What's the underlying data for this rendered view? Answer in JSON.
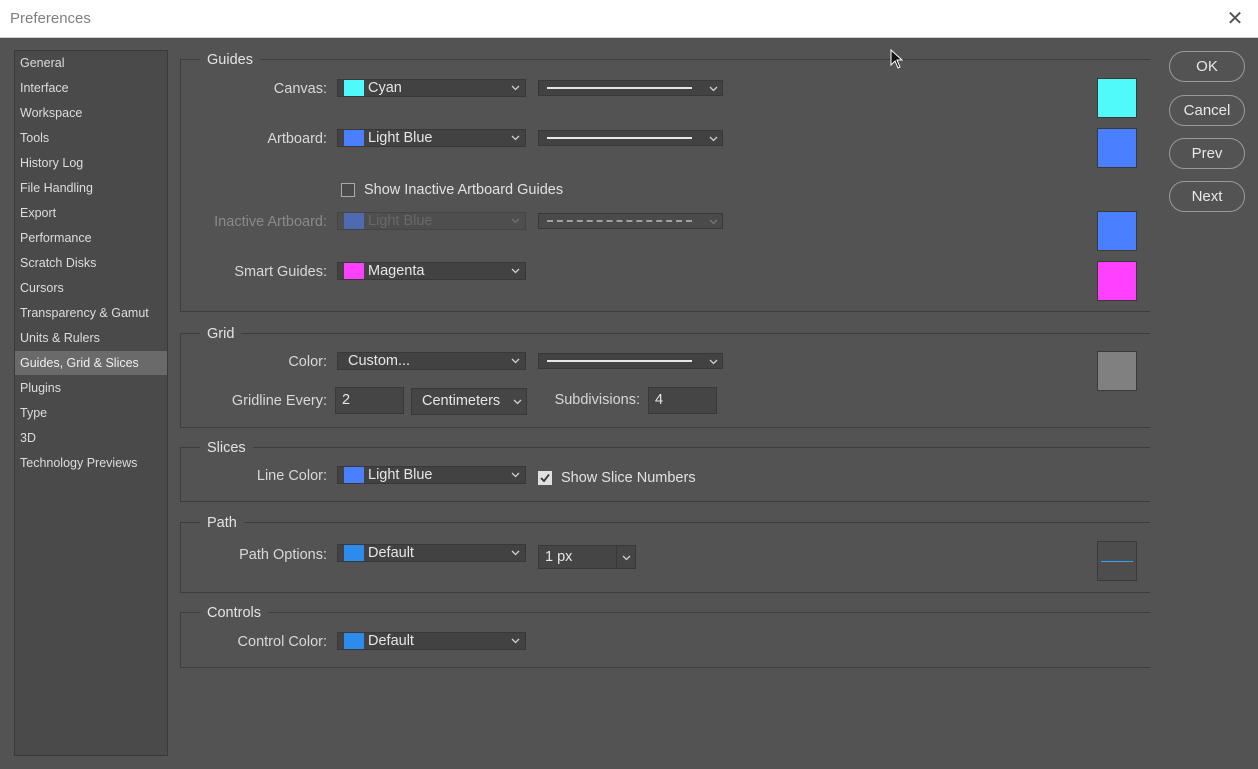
{
  "window": {
    "title": "Preferences",
    "close_glyph": "✕"
  },
  "sidebar": {
    "items": [
      {
        "label": "General"
      },
      {
        "label": "Interface"
      },
      {
        "label": "Workspace"
      },
      {
        "label": "Tools"
      },
      {
        "label": "History Log"
      },
      {
        "label": "File Handling"
      },
      {
        "label": "Export"
      },
      {
        "label": "Performance"
      },
      {
        "label": "Scratch Disks"
      },
      {
        "label": "Cursors"
      },
      {
        "label": "Transparency & Gamut"
      },
      {
        "label": "Units & Rulers"
      },
      {
        "label": "Guides, Grid & Slices"
      },
      {
        "label": "Plugins"
      },
      {
        "label": "Type"
      },
      {
        "label": "3D"
      },
      {
        "label": "Technology Previews"
      }
    ],
    "active": "Guides, Grid & Slices"
  },
  "guides": {
    "heading": "Guides",
    "canvas": {
      "label": "Canvas:",
      "color_name": "Cyan",
      "color": "#50fafa",
      "line_style": "solid"
    },
    "artboard": {
      "label": "Artboard:",
      "color_name": "Light Blue",
      "color": "#4a80ff",
      "line_style": "solid"
    },
    "show_inactive": {
      "label": "Show Inactive Artboard Guides",
      "checked": false
    },
    "inactive_artboard": {
      "label": "Inactive Artboard:",
      "color_name": "Light Blue",
      "color": "#4a80ff",
      "line_style": "dashed"
    },
    "smart_guides": {
      "label": "Smart Guides:",
      "color_name": "Magenta",
      "color": "#ff40ff"
    }
  },
  "grid": {
    "heading": "Grid",
    "color": {
      "label": "Color:",
      "value": "Custom...",
      "swatch": "#808080",
      "line_style": "solid"
    },
    "gridline_every": {
      "label": "Gridline Every:",
      "value": "2",
      "unit": "Centimeters"
    },
    "subdivisions": {
      "label": "Subdivisions:",
      "value": "4"
    }
  },
  "slices": {
    "heading": "Slices",
    "line_color": {
      "label": "Line Color:",
      "color_name": "Light Blue",
      "color": "#4a80ff"
    },
    "show_numbers": {
      "label": "Show Slice Numbers",
      "checked": true
    }
  },
  "path": {
    "heading": "Path",
    "options": {
      "label": "Path Options:",
      "color_name": "Default",
      "color": "#2d8ceb",
      "width": "1 px"
    }
  },
  "controls": {
    "heading": "Controls",
    "control_color": {
      "label": "Control Color:",
      "color_name": "Default",
      "color": "#2d8ceb"
    }
  },
  "buttons": {
    "ok": "OK",
    "cancel": "Cancel",
    "prev": "Prev",
    "next": "Next"
  }
}
